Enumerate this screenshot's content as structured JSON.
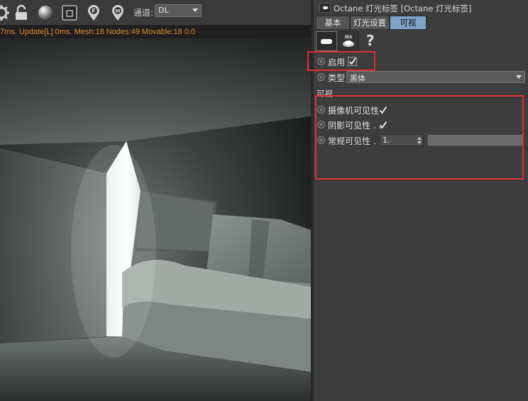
{
  "toolbar": {
    "channel_label": "通道:",
    "channel_value": "DL"
  },
  "render_stats": "7ms. Update[L]:0ms. Mesh:18 Nodes:49 Movable:18  0:0",
  "attributes": {
    "title": "Octane 灯光标签 [Octane 灯光标签]",
    "tabs": [
      {
        "label": "基本",
        "active": false
      },
      {
        "label": "灯光设置",
        "active": false
      },
      {
        "label": "可视",
        "active": true
      }
    ],
    "icon_tabs": [
      {
        "name": "area-light-icon",
        "active": true
      },
      {
        "name": "ies-light-icon",
        "label": "IES",
        "active": false
      },
      {
        "name": "help-icon",
        "label": "?",
        "active": false
      }
    ],
    "enable": {
      "label": "启用",
      "checked": true
    },
    "type": {
      "label": "类型",
      "value": "黑体"
    },
    "visibility_section": {
      "title": "可视",
      "camera": {
        "label": "摄像机可见性",
        "checked": true
      },
      "shadow": {
        "label": "阴影可见性 . .",
        "checked": true
      },
      "general": {
        "label": "常规可见性 . .",
        "value": "1."
      }
    }
  },
  "colors": {
    "accent_tab": "#7fa3c7",
    "stats_text": "#e08a2a",
    "annotation": "#e03030"
  }
}
